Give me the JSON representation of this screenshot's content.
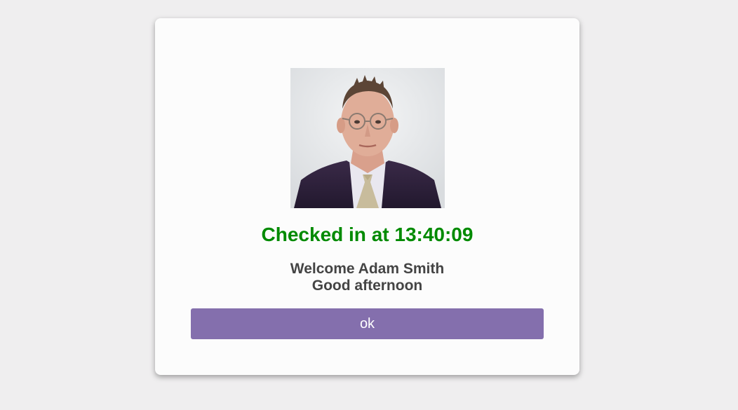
{
  "checkin": {
    "status_text": "Checked in at 13:40:09",
    "welcome_text": "Welcome Adam Smith",
    "salutation_text": "Good afternoon",
    "ok_label": "ok"
  },
  "colors": {
    "status": "#008a00",
    "button": "#846fad",
    "text": "#444444",
    "background": "#efeeef",
    "card": "#fcfcfc"
  },
  "photo": {
    "alt": "Portrait photo of Adam Smith"
  }
}
